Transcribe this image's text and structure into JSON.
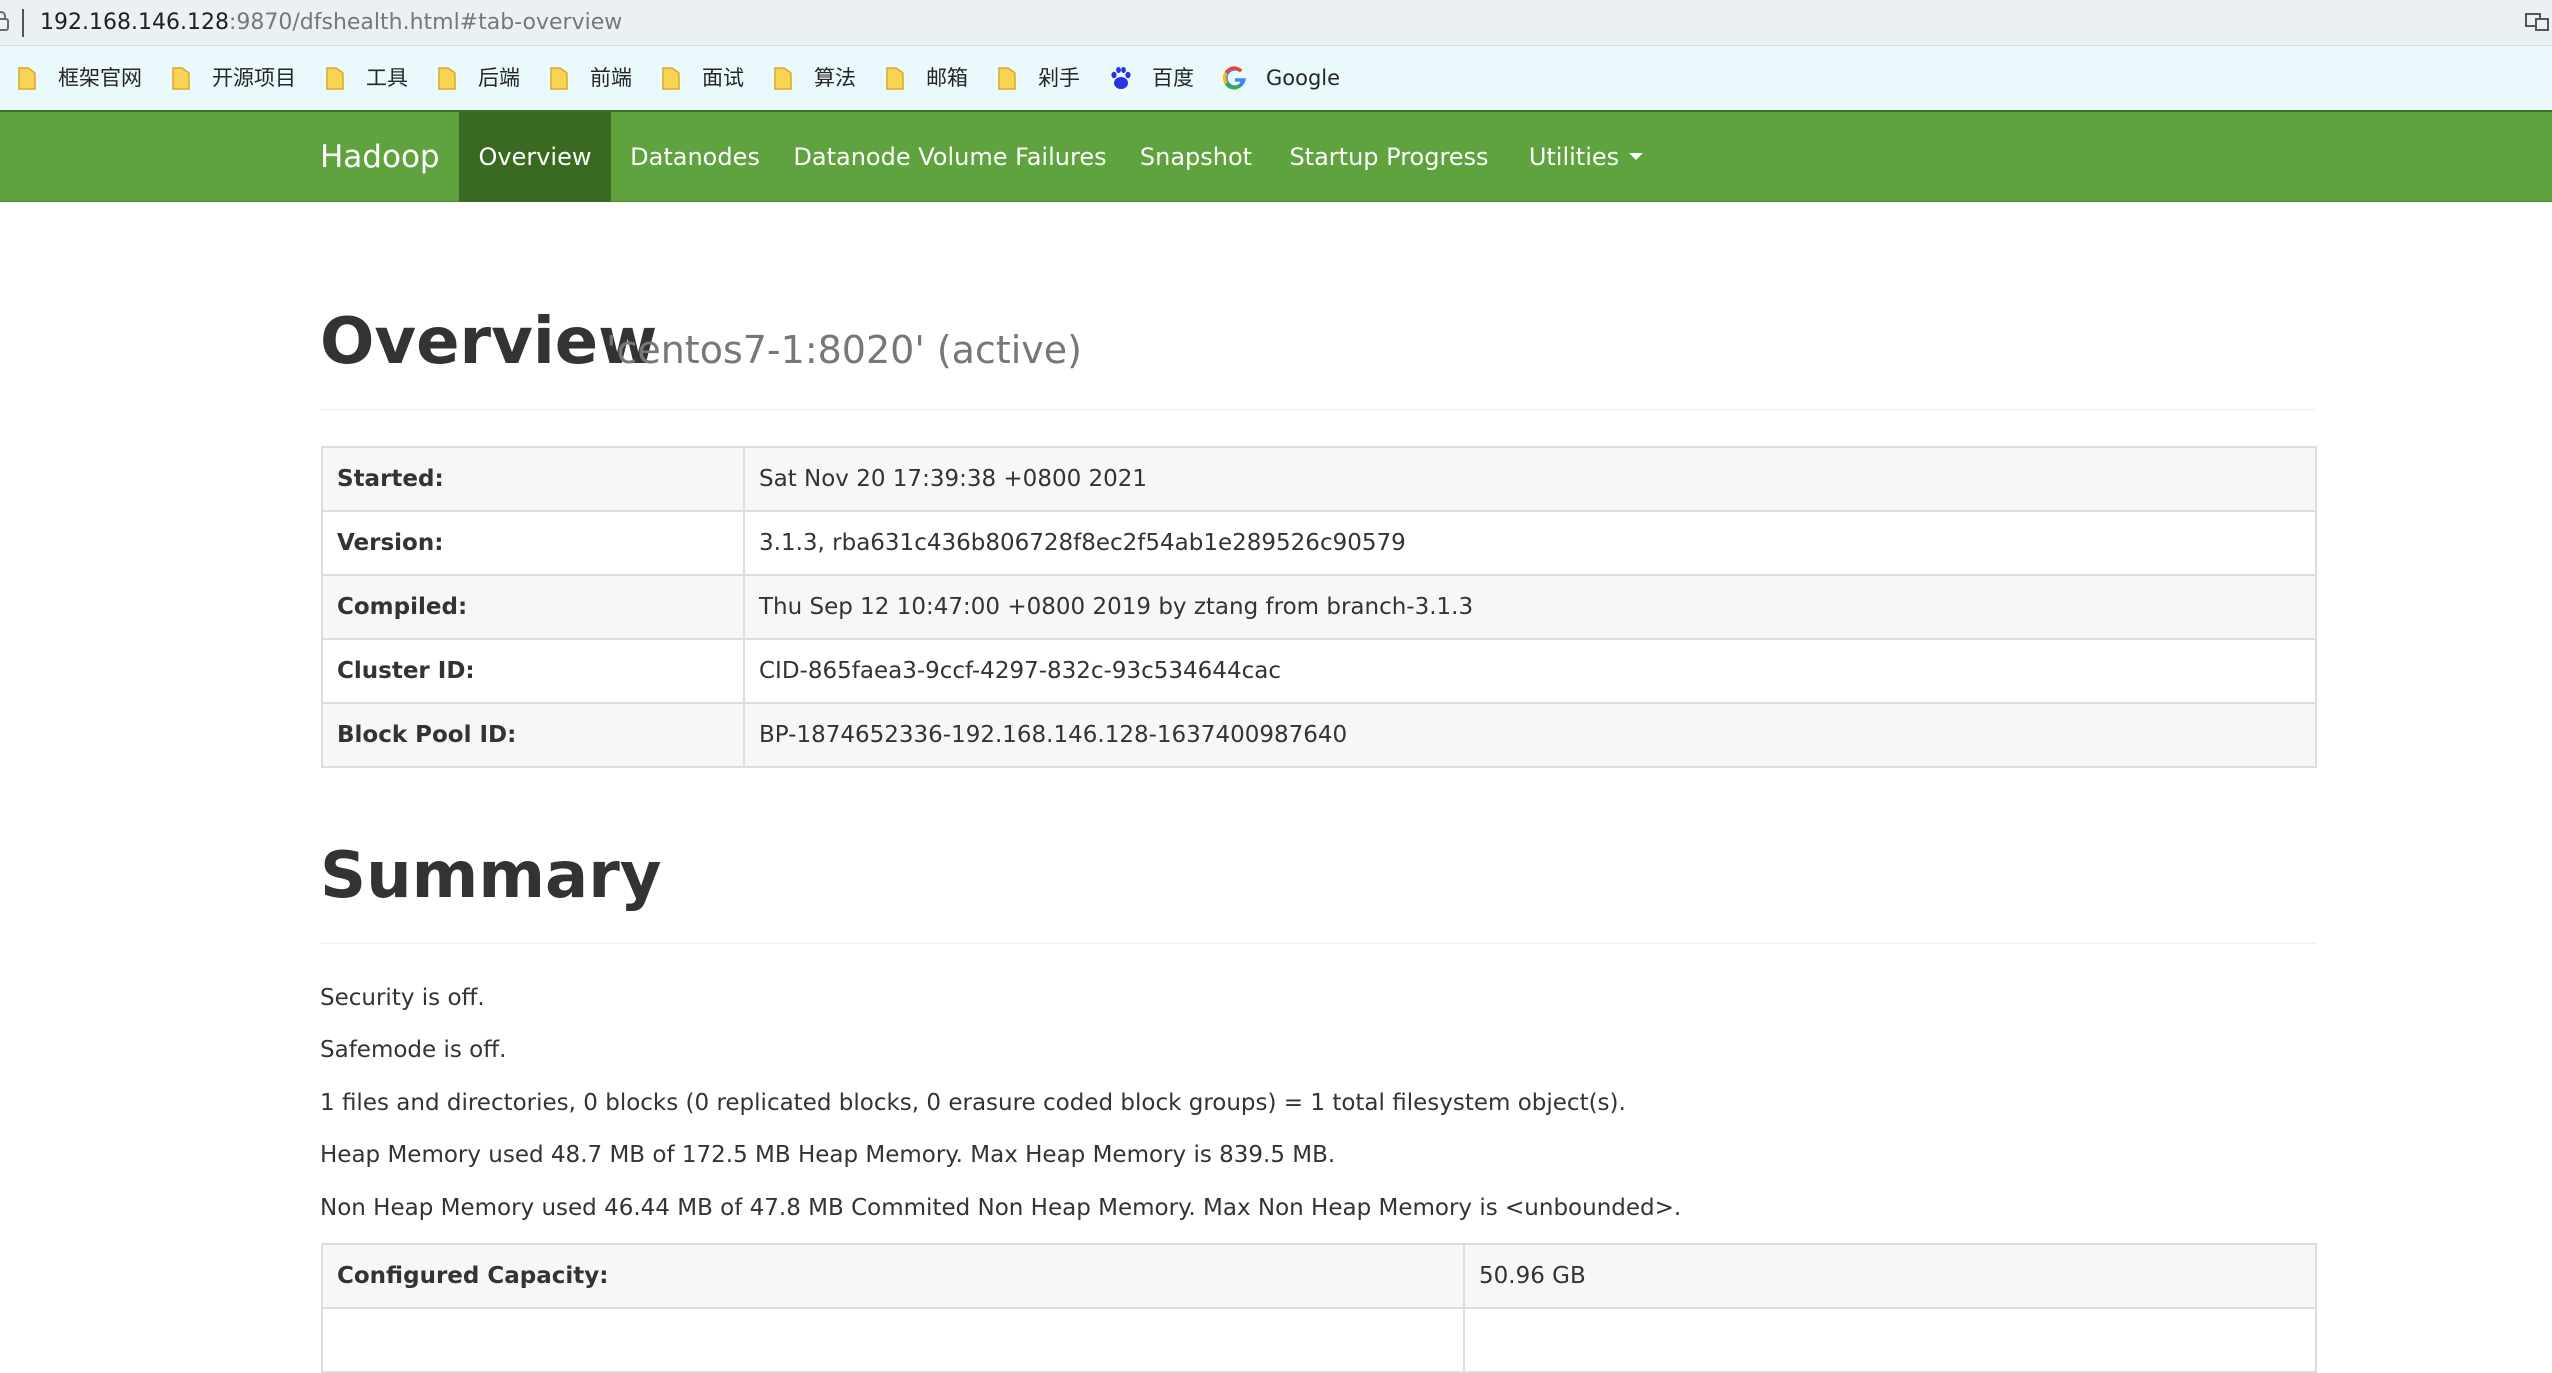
{
  "browser": {
    "url_host": "192.168.146.128",
    "url_rest": ":9870/dfshealth.html#tab-overview",
    "bookmarks": [
      {
        "label": "框架官网",
        "icon": "folder-icon"
      },
      {
        "label": "开源项目",
        "icon": "folder-icon"
      },
      {
        "label": "工具",
        "icon": "folder-icon"
      },
      {
        "label": "后端",
        "icon": "folder-icon"
      },
      {
        "label": "前端",
        "icon": "folder-icon"
      },
      {
        "label": "面试",
        "icon": "folder-icon"
      },
      {
        "label": "算法",
        "icon": "folder-icon"
      },
      {
        "label": "邮箱",
        "icon": "folder-icon"
      },
      {
        "label": "剁手",
        "icon": "folder-icon"
      },
      {
        "label": "百度",
        "icon": "baidu-paw-icon"
      },
      {
        "label": "Google",
        "icon": "google-g-icon"
      }
    ]
  },
  "navbar": {
    "brand": "Hadoop",
    "items": [
      {
        "label": "Overview",
        "active": true
      },
      {
        "label": "Datanodes",
        "active": false
      },
      {
        "label": "Datanode Volume Failures",
        "active": false
      },
      {
        "label": "Snapshot",
        "active": false
      },
      {
        "label": "Startup Progress",
        "active": false
      },
      {
        "label": "Utilities",
        "active": false,
        "dropdown": true
      }
    ],
    "color": "#5fa33e",
    "active_color": "#3a6a22"
  },
  "overview": {
    "title": "Overview",
    "subtitle": "'centos7-1:8020' (active)",
    "rows": [
      {
        "key": "Started:",
        "value": "Sat Nov 20 17:39:38 +0800 2021"
      },
      {
        "key": "Version:",
        "value": "3.1.3, rba631c436b806728f8ec2f54ab1e289526c90579"
      },
      {
        "key": "Compiled:",
        "value": "Thu Sep 12 10:47:00 +0800 2019 by ztang from branch-3.1.3"
      },
      {
        "key": "Cluster ID:",
        "value": "CID-865faea3-9ccf-4297-832c-93c534644cac"
      },
      {
        "key": "Block Pool ID:",
        "value": "BP-1874652336-192.168.146.128-1637400987640"
      }
    ]
  },
  "summary": {
    "title": "Summary",
    "lines": [
      "Security is off.",
      "Safemode is off.",
      "1 files and directories, 0 blocks (0 replicated blocks, 0 erasure coded block groups) = 1 total filesystem object(s).",
      "Heap Memory used 48.7 MB of 172.5 MB Heap Memory. Max Heap Memory is 839.5 MB.",
      "Non Heap Memory used 46.44 MB of 47.8 MB Commited Non Heap Memory. Max Non Heap Memory is <unbounded>."
    ],
    "rows": [
      {
        "key": "Configured Capacity:",
        "value": "50.96 GB"
      },
      {
        "key": "",
        "value": ""
      }
    ]
  }
}
